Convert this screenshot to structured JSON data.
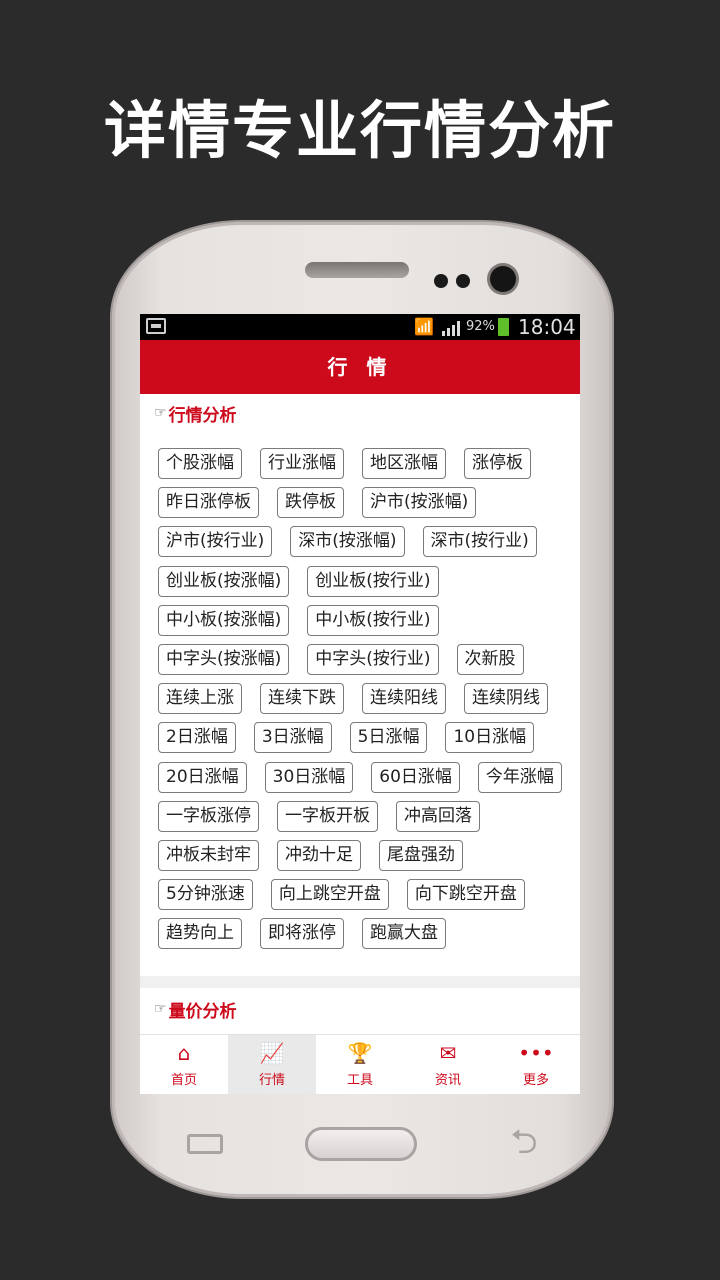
{
  "headline": "详情专业行情分析",
  "status_bar": {
    "battery_percent": "92%",
    "time": "18:04"
  },
  "app": {
    "title": "行 情",
    "section1": {
      "title": "行情分析",
      "rows": [
        [
          "个股涨幅",
          "行业涨幅",
          "地区涨幅",
          "涨停板"
        ],
        [
          "昨日涨停板",
          "跌停板",
          "沪市(按涨幅)"
        ],
        [
          "沪市(按行业)",
          "深市(按涨幅)",
          "深市(按行业)"
        ],
        [
          "创业板(按涨幅)",
          "创业板(按行业)"
        ],
        [
          "中小板(按涨幅)",
          "中小板(按行业)"
        ],
        [
          "中字头(按涨幅)",
          "中字头(按行业)",
          "次新股"
        ],
        [
          "连续上涨",
          "连续下跌",
          "连续阳线",
          "连续阴线"
        ],
        [
          "2日涨幅",
          "3日涨幅",
          "5日涨幅",
          "10日涨幅"
        ],
        [
          "20日涨幅",
          "30日涨幅",
          "60日涨幅",
          "今年涨幅"
        ],
        [
          "一字板涨停",
          "一字板开板",
          "冲高回落"
        ],
        [
          "冲板未封牢",
          "冲劲十足",
          "尾盘强劲"
        ],
        [
          "5分钟涨速",
          "向上跳空开盘",
          "向下跳空开盘"
        ],
        [
          "趋势向上",
          "即将涨停",
          "跑赢大盘"
        ]
      ]
    },
    "section2": {
      "title": "量价分析"
    },
    "tabs": [
      {
        "label": "首页",
        "icon": "home-icon",
        "active": false
      },
      {
        "label": "行情",
        "icon": "chart-icon",
        "active": true
      },
      {
        "label": "工具",
        "icon": "trophy-icon",
        "active": false
      },
      {
        "label": "资讯",
        "icon": "news-icon",
        "active": false
      },
      {
        "label": "更多",
        "icon": "more-icon",
        "active": false
      }
    ],
    "accent_color": "#cc0a1c"
  }
}
